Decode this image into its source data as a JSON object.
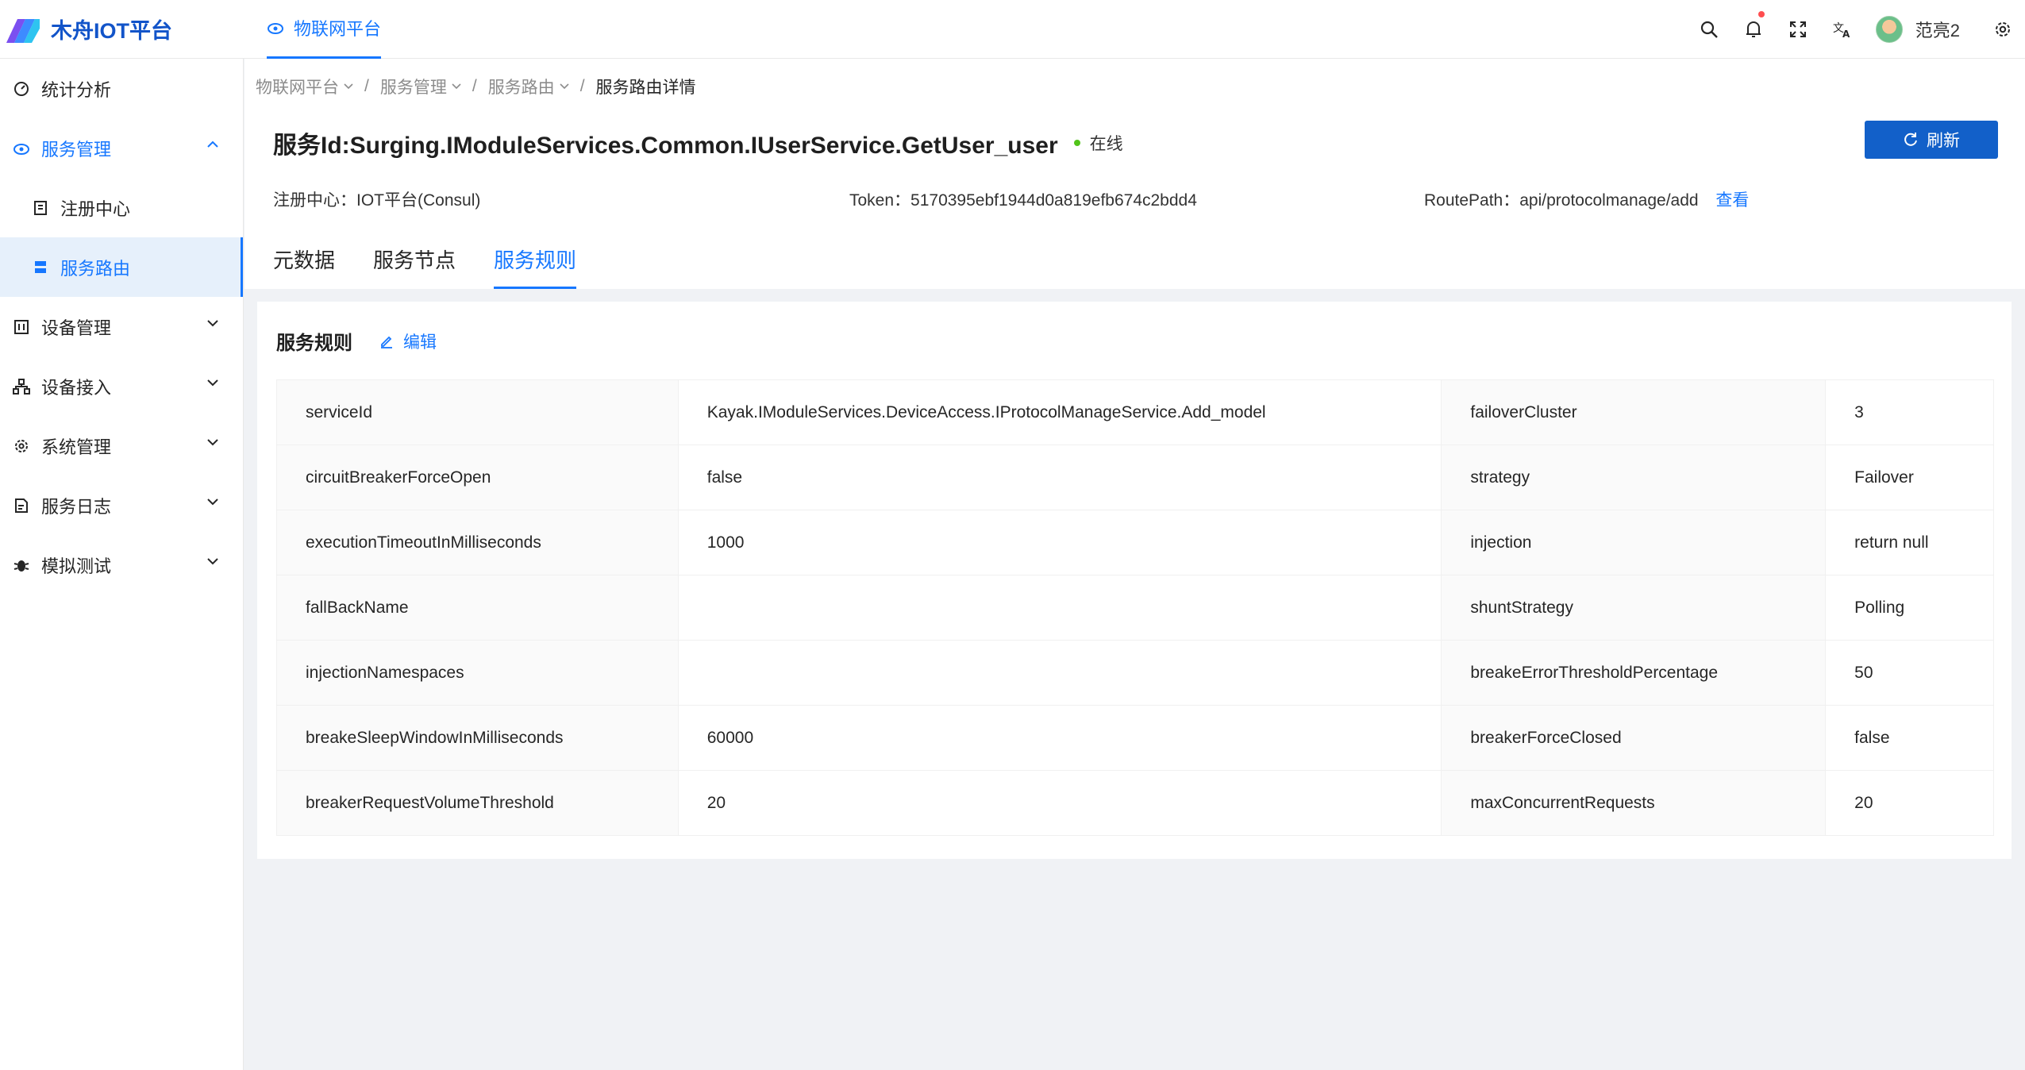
{
  "brand": {
    "name": "木舟IOT平台"
  },
  "top_tab": {
    "label": "物联网平台"
  },
  "user": {
    "name": "范亮2"
  },
  "colors": {
    "primary": "#1677ff",
    "button": "#1260c9",
    "online": "#52c41a",
    "notification_dot": "#ff4d4f"
  },
  "header_icons": [
    "search-icon",
    "bell-icon",
    "fullscreen-icon",
    "translate-icon",
    "settings-icon"
  ],
  "sidebar": {
    "items": [
      {
        "label": "统计分析",
        "icon": "dashboard-icon"
      },
      {
        "label": "服务管理",
        "icon": "cloud-icon",
        "expanded": true
      },
      {
        "label": "注册中心",
        "icon": "registry-icon"
      },
      {
        "label": "服务路由",
        "icon": "server-icon",
        "active": true
      },
      {
        "label": "设备管理",
        "icon": "device-icon"
      },
      {
        "label": "设备接入",
        "icon": "network-icon"
      },
      {
        "label": "系统管理",
        "icon": "gear-icon"
      },
      {
        "label": "服务日志",
        "icon": "log-icon"
      },
      {
        "label": "模拟测试",
        "icon": "bug-icon"
      }
    ]
  },
  "breadcrumb": {
    "items": [
      "物联网平台",
      "服务管理",
      "服务路由"
    ],
    "separator": "/",
    "current": "服务路由详情"
  },
  "page": {
    "title": "服务Id:Surging.IModuleServices.Common.IUserService.GetUser_user",
    "status": "在线",
    "refresh_label": "刷新"
  },
  "info": {
    "registry": "注册中心：IOT平台(Consul)",
    "token": "Token：5170395ebf1944d0a819efb674c2bdd4",
    "route_path": "RoutePath：api/protocolmanage/add",
    "view_label": "查看"
  },
  "tabs": [
    {
      "label": "元数据"
    },
    {
      "label": "服务节点"
    },
    {
      "label": "服务规则",
      "active": true
    }
  ],
  "card": {
    "title": "服务规则",
    "edit_label": "编辑"
  },
  "rules": [
    {
      "k1": "serviceId",
      "v1": "Kayak.IModuleServices.DeviceAccess.IProtocolManageService.Add_model",
      "k2": "failoverCluster",
      "v2": "3"
    },
    {
      "k1": "circuitBreakerForceOpen",
      "v1": "false",
      "k2": "strategy",
      "v2": "Failover"
    },
    {
      "k1": "executionTimeoutInMilliseconds",
      "v1": "1000",
      "k2": "injection",
      "v2": "return null"
    },
    {
      "k1": "fallBackName",
      "v1": "",
      "k2": "shuntStrategy",
      "v2": "Polling"
    },
    {
      "k1": "injectionNamespaces",
      "v1": "",
      "k2": "breakeErrorThresholdPercentage",
      "v2": "50"
    },
    {
      "k1": "breakeSleepWindowInMilliseconds",
      "v1": "60000",
      "k2": "breakerForceClosed",
      "v2": "false"
    },
    {
      "k1": "breakerRequestVolumeThreshold",
      "v1": "20",
      "k2": "maxConcurrentRequests",
      "v2": "20"
    }
  ]
}
